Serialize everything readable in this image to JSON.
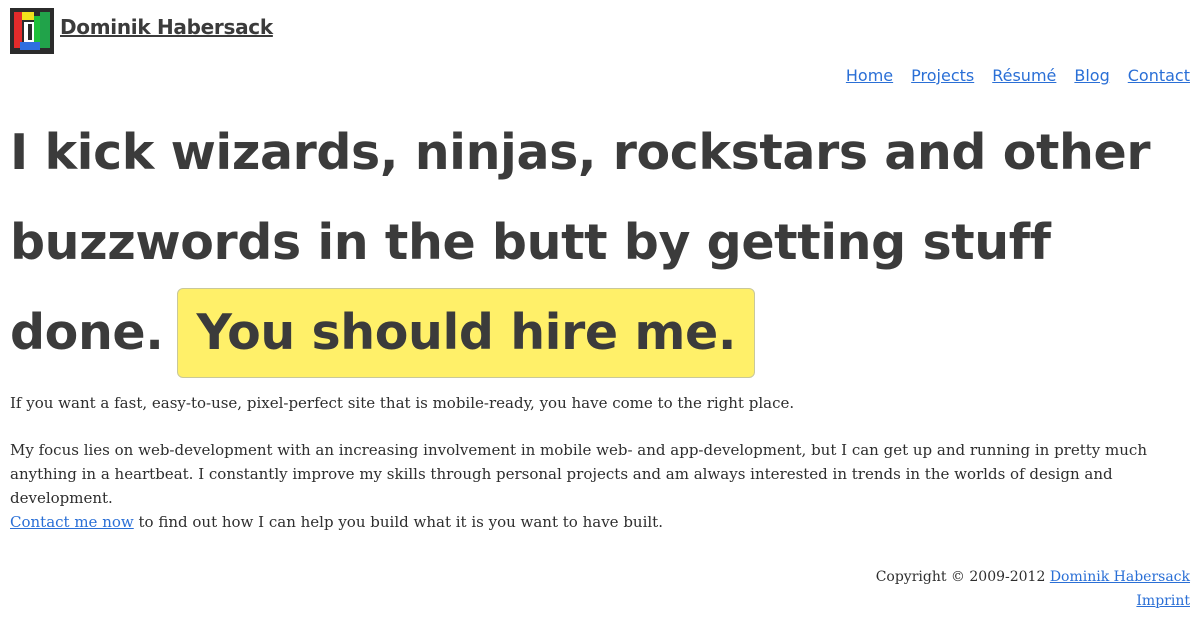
{
  "header": {
    "site_name": "Dominik Habersack"
  },
  "nav": {
    "items": [
      "Home",
      "Projects",
      "Résumé",
      "Blog",
      "Contact"
    ]
  },
  "hero": {
    "headline": "I kick wizards, ninjas, rockstars and other buzzwords in the butt by getting stuff done.",
    "highlight": "You should hire me."
  },
  "content": {
    "p1": "If you want a fast, easy-to-use, pixel-perfect site that is mobile-ready, you have come to the right place.",
    "p2": "My focus lies on web-development with an increasing involvement in mobile web- and app-development, but I can get up and running in pretty much anything in a heartbeat. I constantly improve my skills through personal projects and am always interested in trends in the worlds of design and development.",
    "contact_link": "Contact me now",
    "p3_rest": " to find out how I can help you build what it is you want to have built."
  },
  "footer": {
    "copyright": "Copyright © 2009-2012 ",
    "author_link": "Dominik Habersack",
    "imprint_link": "Imprint"
  },
  "colors": {
    "link": "#2a6fd6",
    "highlight_bg": "#fff069",
    "text": "#3b3b3b"
  }
}
